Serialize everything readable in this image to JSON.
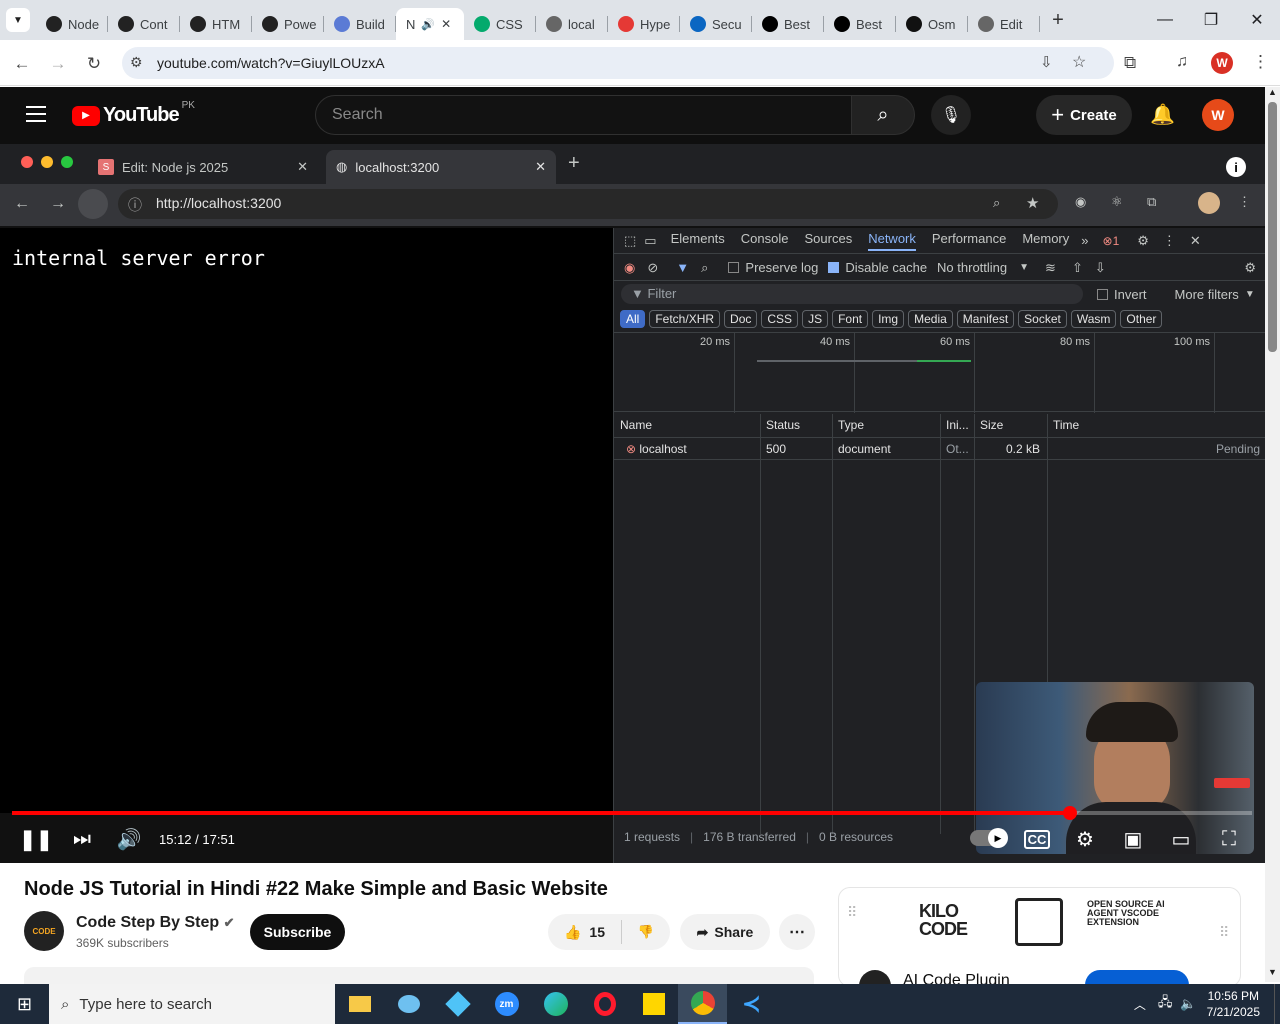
{
  "browser": {
    "tabs": [
      {
        "label": "Node",
        "icon": "openai-icon"
      },
      {
        "label": "Cont",
        "icon": "openai-icon"
      },
      {
        "label": "HTM",
        "icon": "openai-icon"
      },
      {
        "label": "Powe",
        "icon": "openai-icon"
      },
      {
        "label": "Build",
        "icon": "build-icon"
      },
      {
        "label": "N",
        "icon": "audio-icon",
        "active": true
      },
      {
        "label": "CSS",
        "icon": "w3-icon"
      },
      {
        "label": "local",
        "icon": "globe-icon"
      },
      {
        "label": "Hype",
        "icon": "hyper-icon"
      },
      {
        "label": "Secu",
        "icon": "linkedin-icon"
      },
      {
        "label": "Best",
        "icon": "x-icon"
      },
      {
        "label": "Best",
        "icon": "x-icon"
      },
      {
        "label": "Osm",
        "icon": "osmo-icon"
      },
      {
        "label": "Edit",
        "icon": "globe-icon"
      }
    ],
    "url": "youtube.com/watch?v=GiuylLOUzxA",
    "profile_letter": "W"
  },
  "youtube": {
    "logo_text": "YouTube",
    "country": "PK",
    "search_placeholder": "Search",
    "create_label": "Create",
    "avatar_letter": "W"
  },
  "inner_browser": {
    "tabs": [
      {
        "label": "Edit: Node js 2025",
        "icon_letter": "S"
      },
      {
        "label": "localhost:3200"
      }
    ],
    "url": "http://localhost:3200",
    "page_text": "internal server error"
  },
  "devtools": {
    "panels": [
      "Elements",
      "Console",
      "Sources",
      "Network",
      "Performance",
      "Memory"
    ],
    "active_panel": "Network",
    "error_count": "1",
    "toolbar": {
      "preserve_log": "Preserve log",
      "disable_cache": "Disable cache",
      "throttling": "No throttling"
    },
    "filter_placeholder": "Filter",
    "invert_label": "Invert",
    "more_filters": "More filters",
    "filter_chips": [
      "All",
      "Fetch/XHR",
      "Doc",
      "CSS",
      "JS",
      "Font",
      "Img",
      "Media",
      "Manifest",
      "Socket",
      "Wasm",
      "Other"
    ],
    "timeline_ticks": [
      "20 ms",
      "40 ms",
      "60 ms",
      "80 ms",
      "100 ms"
    ],
    "columns": [
      "Name",
      "Status",
      "Type",
      "Ini...",
      "Size",
      "Time"
    ],
    "rows": [
      {
        "name": "localhost",
        "status": "500",
        "type": "document",
        "initiator": "Ot...",
        "size": "0.2 kB",
        "time": "Pending"
      }
    ],
    "footer": {
      "requests": "1 requests",
      "transferred": "176 B transferred",
      "resources": "0 B resources"
    }
  },
  "player": {
    "time": "15:12 / 17:51",
    "progress": 0.853
  },
  "video_info": {
    "title": "Node JS Tutorial in Hindi #22 Make Simple and Basic Website",
    "channel": "Code Step By Step",
    "subscribers": "369K subscribers",
    "subscribe_label": "Subscribe",
    "likes": "15",
    "share_label": "Share"
  },
  "ad": {
    "brand": "KILO CODE",
    "tagline": "OPEN SOURCE AI AGENT VSCODE EXTENSION",
    "title": "AI Code Plugin"
  },
  "taskbar": {
    "search_placeholder": "Type here to search",
    "time": "10:56 PM",
    "date": "7/21/2025"
  }
}
